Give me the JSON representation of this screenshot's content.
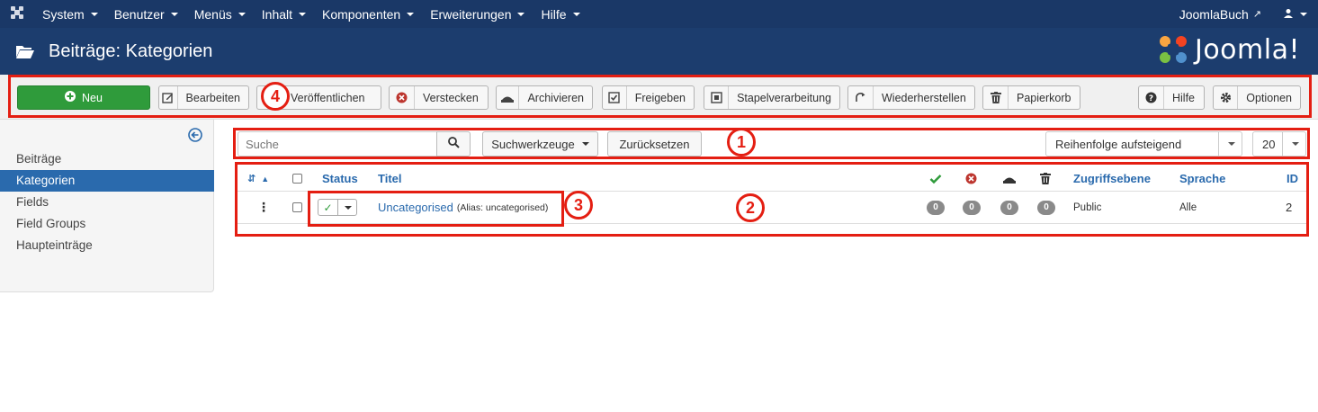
{
  "topnav": {
    "logo_icon": "joomla-icon",
    "menu": [
      {
        "label": "System"
      },
      {
        "label": "Benutzer"
      },
      {
        "label": "Menüs"
      },
      {
        "label": "Inhalt"
      },
      {
        "label": "Komponenten"
      },
      {
        "label": "Erweiterungen"
      },
      {
        "label": "Hilfe"
      }
    ],
    "site_link": "JoomlaBuch",
    "user_icon": "user-icon"
  },
  "header": {
    "title": "Beiträge: Kategorien",
    "brand": "Joomla!",
    "folder_icon": "folder-open-icon"
  },
  "toolbar": {
    "new": "Neu",
    "edit": "Bearbeiten",
    "publish": "Veröffentlichen",
    "unpublish": "Verstecken",
    "archive": "Archivieren",
    "checkin": "Freigeben",
    "batch": "Stapelverarbeitung",
    "rebuild": "Wiederherstellen",
    "trash": "Papierkorb",
    "help": "Hilfe",
    "options": "Optionen"
  },
  "sidebar": {
    "items": [
      {
        "label": "Beiträge",
        "active": false
      },
      {
        "label": "Kategorien",
        "active": true
      },
      {
        "label": "Fields",
        "active": false
      },
      {
        "label": "Field Groups",
        "active": false
      },
      {
        "label": "Haupteinträge",
        "active": false
      }
    ]
  },
  "filters": {
    "search_placeholder": "Suche",
    "search_tools": "Suchwerkzeuge",
    "reset": "Zurücksetzen",
    "ordering": "Reihenfolge aufsteigend",
    "limit": "20"
  },
  "table": {
    "headers": {
      "status": "Status",
      "title": "Titel",
      "access": "Zugriffsebene",
      "language": "Sprache",
      "id": "ID"
    },
    "rows": [
      {
        "title": "Uncategorised",
        "alias": "(Alias: uncategorised)",
        "published": "0",
        "unpublished": "0",
        "archived": "0",
        "trashed": "0",
        "access": "Public",
        "language": "Alle",
        "id": "2"
      }
    ]
  },
  "annotations": {
    "marker1": "1",
    "marker2": "2",
    "marker3": "3",
    "marker4": "4"
  },
  "colors": {
    "nav_bg": "#1a3867",
    "header_bg": "#1c3d6e",
    "accent": "#2a6aad",
    "new_button": "#2f9b3b",
    "annotation_red": "#e41e12"
  }
}
